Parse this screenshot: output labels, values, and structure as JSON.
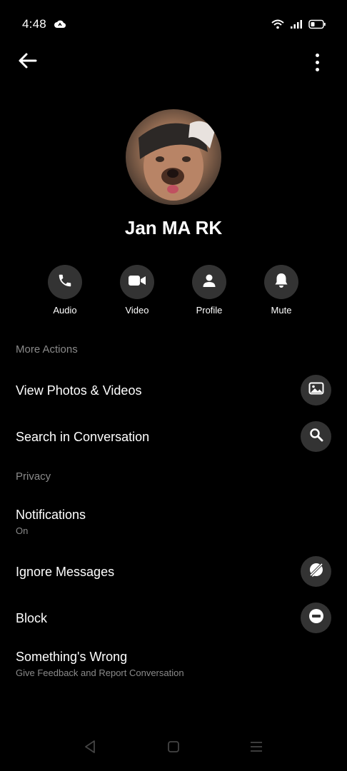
{
  "status": {
    "time": "4:48"
  },
  "contact": {
    "name": "Jan MA RK"
  },
  "actions": [
    {
      "label": "Audio",
      "icon": "phone-icon"
    },
    {
      "label": "Video",
      "icon": "video-camera-icon"
    },
    {
      "label": "Profile",
      "icon": "person-icon"
    },
    {
      "label": "Mute",
      "icon": "bell-icon"
    }
  ],
  "sections": {
    "more_actions": "More Actions",
    "privacy": "Privacy"
  },
  "rows": {
    "view_photos": {
      "title": "View Photos & Videos",
      "icon": "image-icon"
    },
    "search": {
      "title": "Search in Conversation",
      "icon": "search-icon"
    },
    "notifications": {
      "title": "Notifications",
      "subtitle": "On"
    },
    "ignore": {
      "title": "Ignore Messages",
      "icon": "ignore-icon"
    },
    "block": {
      "title": "Block",
      "icon": "block-icon"
    },
    "wrong": {
      "title": "Something's Wrong",
      "subtitle": "Give Feedback and Report Conversation"
    }
  },
  "colors": {
    "background": "#000000",
    "circle": "#333333",
    "muted_text": "#8a8a8a"
  }
}
